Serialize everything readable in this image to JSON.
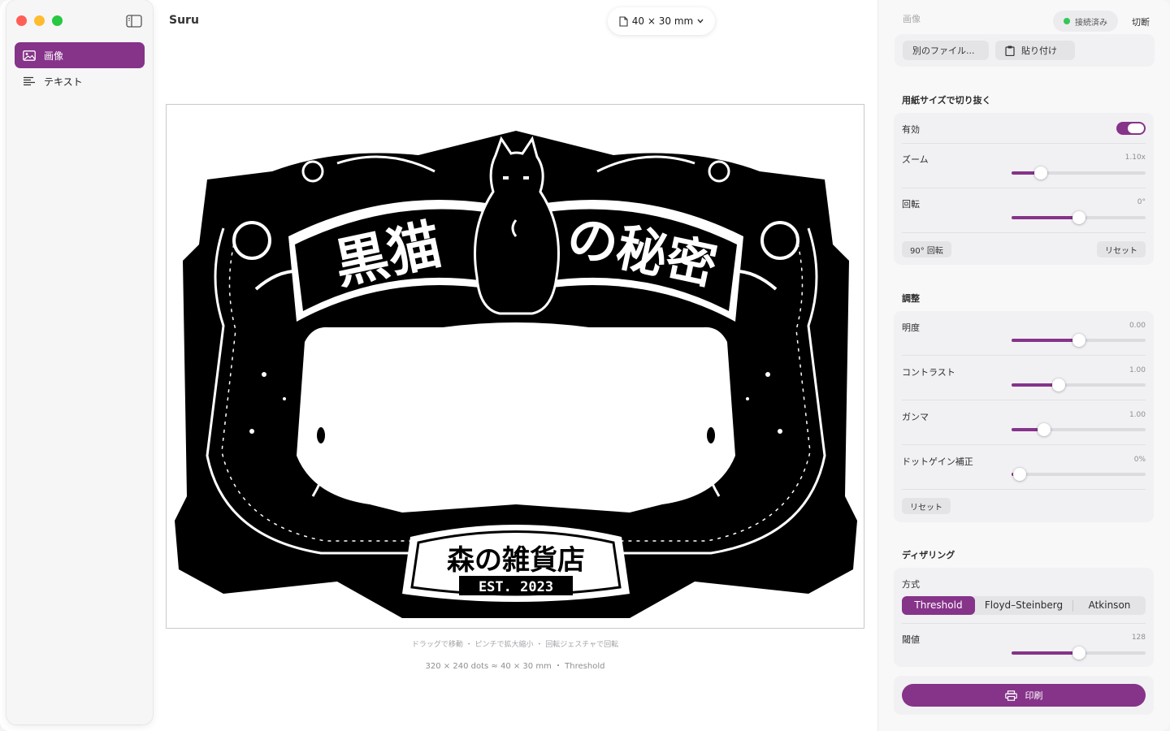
{
  "window": {
    "title": "Suru"
  },
  "sidebar": {
    "items": [
      {
        "label": "画像",
        "icon": "image-icon",
        "active": true
      },
      {
        "label": "テキスト",
        "icon": "text-lines-icon",
        "active": false
      }
    ]
  },
  "toolbar": {
    "paper_size": "40 × 30 mm"
  },
  "canvas": {
    "hint": "ドラッグで移動 ・ ピンチで拡大縮小 ・ 回転ジェスチャで回転",
    "info": "320 × 240 dots ≈ 40 × 30 mm ・ Threshold",
    "art": {
      "title_left": "黒猫",
      "title_right": "の秘密",
      "shop": "森の雑貨店",
      "est": "EST. 2023"
    }
  },
  "panel": {
    "image_section": {
      "title": "画像",
      "other_file": "別のファイル...",
      "paste": "貼り付け"
    },
    "connection": {
      "status": "接続済み",
      "disconnect": "切断",
      "status_color": "#34c759"
    },
    "crop": {
      "title": "用紙サイズで切り抜く",
      "enabled_label": "有効",
      "enabled": true,
      "zoom_label": "ズーム",
      "zoom_value": "1.10x",
      "zoom_fraction": 0.22,
      "rotate_label": "回転",
      "rotate_value": "0°",
      "rotate_fraction": 0.5,
      "rotate90": "90° 回転",
      "reset": "リセット"
    },
    "adjust": {
      "title": "調整",
      "brightness_label": "明度",
      "brightness_value": "0.00",
      "brightness_fraction": 0.5,
      "contrast_label": "コントラスト",
      "contrast_value": "1.00",
      "contrast_fraction": 0.35,
      "gamma_label": "ガンマ",
      "gamma_value": "1.00",
      "gamma_fraction": 0.24,
      "dotgain_label": "ドットゲイン補正",
      "dotgain_value": "0%",
      "dotgain_fraction": 0.06,
      "reset": "リセット"
    },
    "dither": {
      "title": "ディザリング",
      "method_label": "方式",
      "methods": [
        "Threshold",
        "Floyd–Steinberg",
        "Atkinson"
      ],
      "selected": "Threshold",
      "threshold_label": "閾値",
      "threshold_value": "128",
      "threshold_fraction": 0.5
    },
    "print": {
      "label": "印刷"
    }
  },
  "colors": {
    "accent": "#86338a"
  }
}
